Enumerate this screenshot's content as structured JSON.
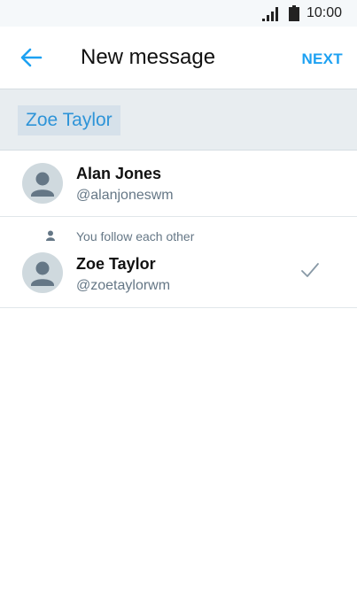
{
  "status_bar": {
    "time": "10:00",
    "signal_icon": "cell-signal-icon",
    "battery_icon": "battery-icon"
  },
  "header": {
    "back_icon": "arrow-left-icon",
    "title": "New message",
    "next_label": "NEXT"
  },
  "recipients": {
    "selected": [
      "Zoe Taylor"
    ]
  },
  "results": [
    {
      "name": "Alan Jones",
      "handle": "@alanjoneswm",
      "context": "",
      "selected": false
    },
    {
      "name": "Zoe Taylor",
      "handle": "@zoetaylorwm",
      "context": "You follow each other",
      "context_icon": "person-icon",
      "selected": true,
      "selected_icon": "checkmark-icon"
    }
  ],
  "colors": {
    "accent": "#1da1f2",
    "chip_text": "#2e94d8",
    "chip_background": "#d6e1ea",
    "recipient_bar": "#e8edf0",
    "secondary_text": "#657786",
    "avatar_bg": "#cfd9de",
    "avatar_fg": "#657786"
  }
}
